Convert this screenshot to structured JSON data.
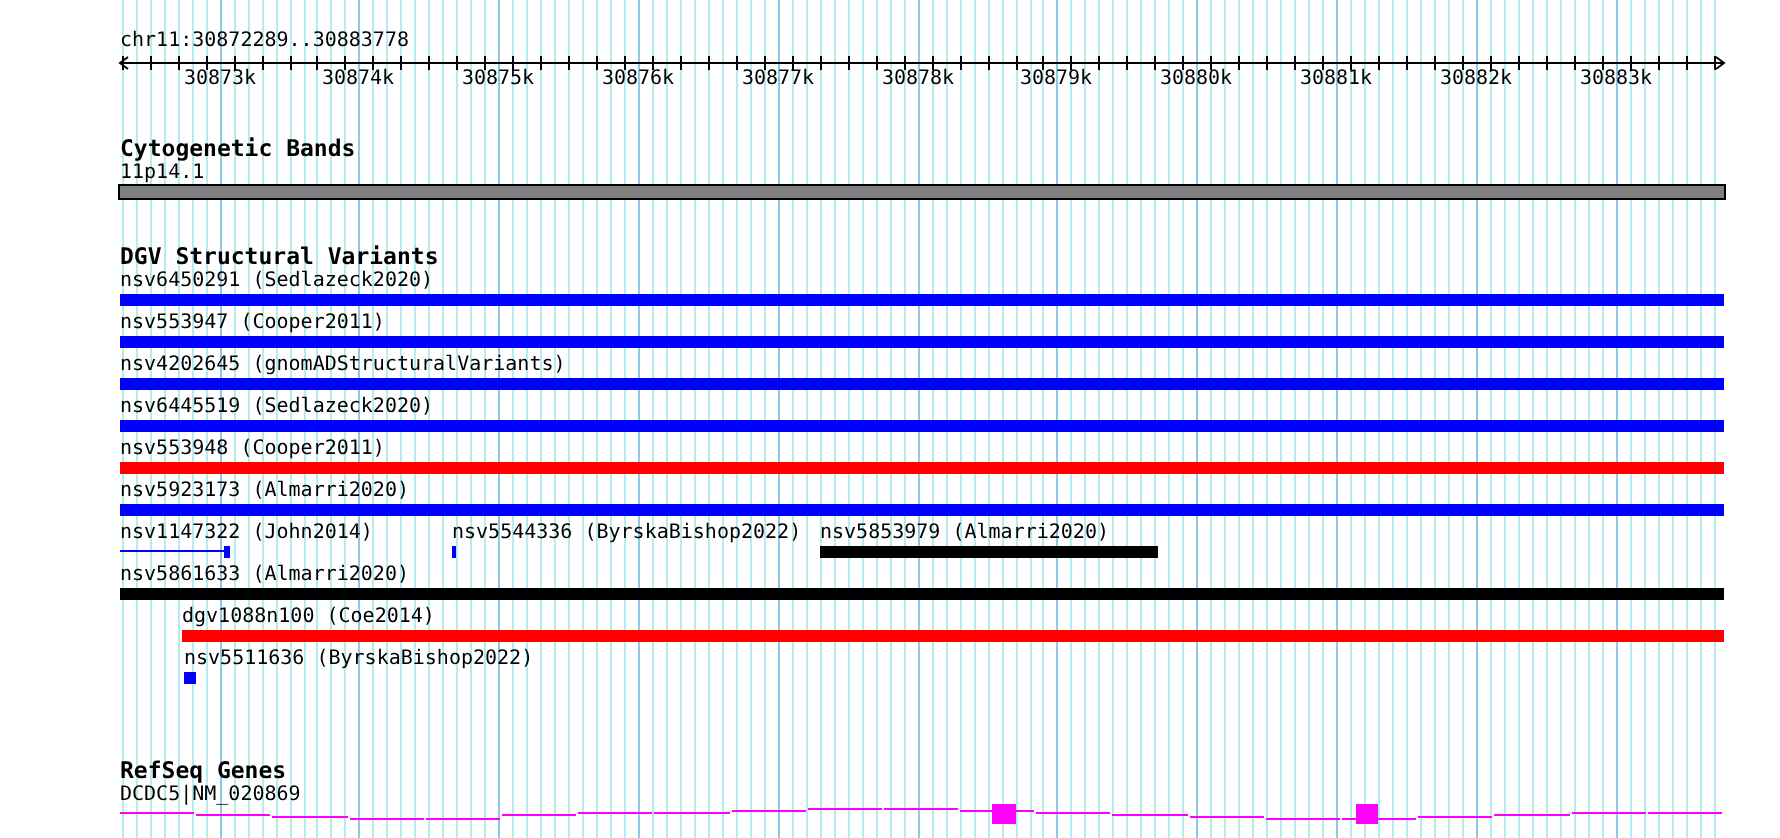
{
  "position": "chr11:30872289..30883778",
  "ruler": {
    "ticks": [
      "30873k",
      "30874k",
      "30875k",
      "30876k",
      "30877k",
      "30878k",
      "30879k",
      "30880k",
      "30881k",
      "30882k",
      "30883k"
    ]
  },
  "tracks": [
    {
      "title": "Cytogenetic Bands",
      "kind": "bands",
      "features": [
        {
          "label": "11p14.1"
        }
      ]
    },
    {
      "title": "DGV Structural Variants",
      "kind": "variants",
      "features": [
        {
          "label": "nsv6450291 (Sedlazeck2020)",
          "color": "#0000ff"
        },
        {
          "label": "nsv553947 (Cooper2011)",
          "color": "#0000ff"
        },
        {
          "label": "nsv4202645 (gnomADStructuralVariants)",
          "color": "#0000ff"
        },
        {
          "label": "nsv6445519 (Sedlazeck2020)",
          "color": "#0000ff"
        },
        {
          "label": "nsv553948 (Cooper2011)",
          "color": "#ff0000"
        },
        {
          "label": "nsv5923173 (Almarri2020)",
          "color": "#0000ff"
        },
        {
          "label": "nsv1147322 (John2014)",
          "color": "#0000ff"
        },
        {
          "label": "nsv5544336 (ByrskaBishop2022)",
          "color": "#0000ff"
        },
        {
          "label": "nsv5853979 (Almarri2020)",
          "color": "#000000"
        },
        {
          "label": "nsv5861633 (Almarri2020)",
          "color": "#000000"
        },
        {
          "label": "dgv1088n100 (Coe2014)",
          "color": "#ff0000"
        },
        {
          "label": "nsv5511636 (ByrskaBishop2022)",
          "color": "#0000ff"
        }
      ]
    },
    {
      "title": "RefSeq Genes",
      "kind": "genes",
      "features": [
        {
          "label": "DCDC5|NM_020869"
        }
      ]
    }
  ]
}
